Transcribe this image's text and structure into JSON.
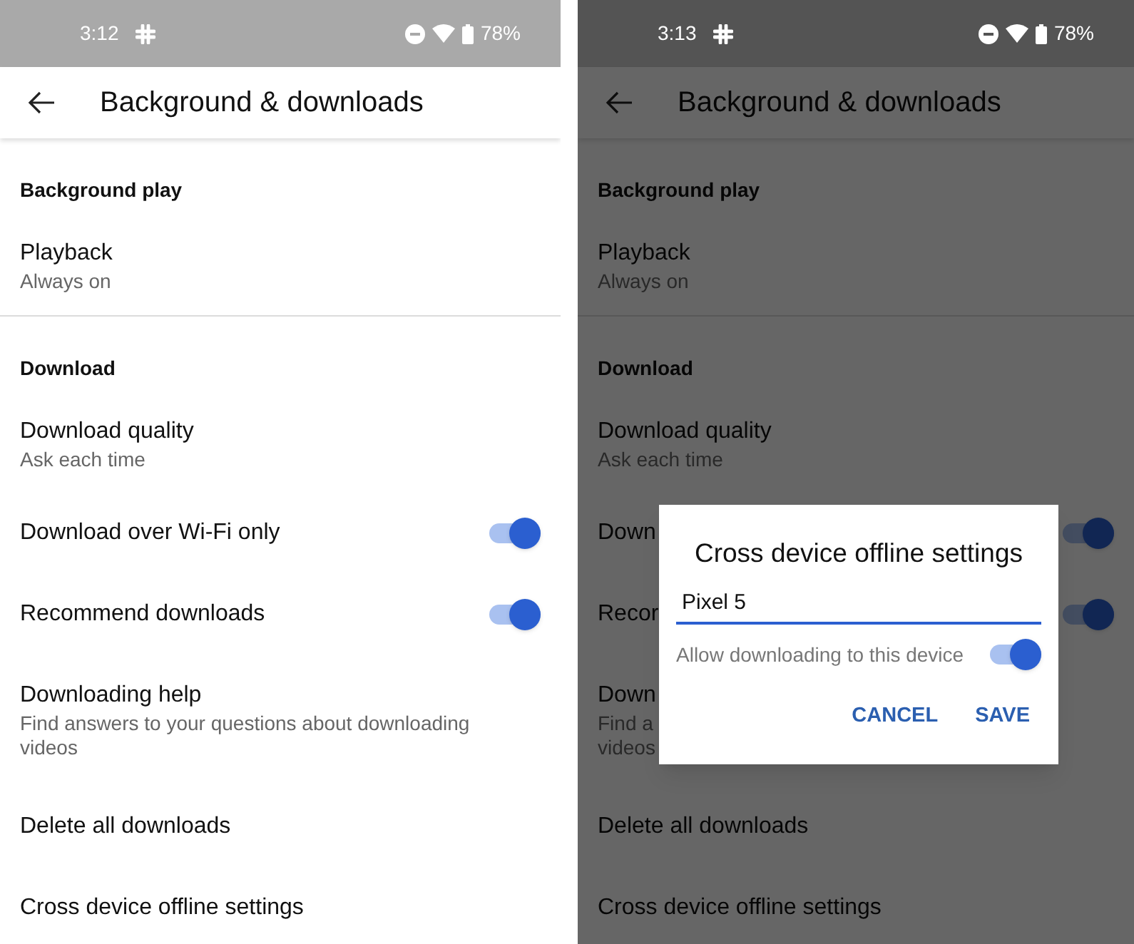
{
  "screens": [
    {
      "dimmed": false,
      "status_bar": {
        "time": "3:12",
        "battery": "78%"
      },
      "title": "Background & downloads",
      "sections": [
        {
          "header": "Background play",
          "items": [
            {
              "kind": "text",
              "title": "Playback",
              "subtitle": "Always on"
            }
          ]
        },
        {
          "header": "Download",
          "items": [
            {
              "kind": "text",
              "title": "Download quality",
              "subtitle": "Ask each time"
            },
            {
              "kind": "toggle",
              "title": "Download over Wi-Fi only",
              "on": true
            },
            {
              "kind": "toggle",
              "title": "Recommend downloads",
              "on": true
            },
            {
              "kind": "text",
              "title": "Downloading help",
              "subtitle": "Find answers to your questions about downloading videos"
            },
            {
              "kind": "text",
              "title": "Delete all downloads"
            },
            {
              "kind": "text",
              "title": "Cross device offline settings"
            }
          ]
        }
      ]
    },
    {
      "dimmed": true,
      "status_bar": {
        "time": "3:13",
        "battery": "78%"
      },
      "title": "Background & downloads",
      "sections": [
        {
          "header": "Background play",
          "items": [
            {
              "kind": "text",
              "title": "Playback",
              "subtitle": "Always on"
            }
          ]
        },
        {
          "header": "Download",
          "items": [
            {
              "kind": "text",
              "title": "Download quality",
              "subtitle": "Ask each time"
            },
            {
              "kind": "toggle",
              "title": "Down",
              "on": true
            },
            {
              "kind": "toggle",
              "title": "Recor",
              "on": true
            },
            {
              "kind": "text",
              "title": "Down",
              "subtitle_lines": [
                "Find a",
                "videos"
              ]
            },
            {
              "kind": "text",
              "title": "Delete all downloads"
            },
            {
              "kind": "text",
              "title": "Cross device offline settings"
            }
          ]
        }
      ],
      "dialog": {
        "title": "Cross device offline settings",
        "field_value": "Pixel 5",
        "toggle": {
          "label": "Allow downloading to this device",
          "on": true
        },
        "buttons": [
          "CANCEL",
          "SAVE"
        ]
      }
    }
  ]
}
